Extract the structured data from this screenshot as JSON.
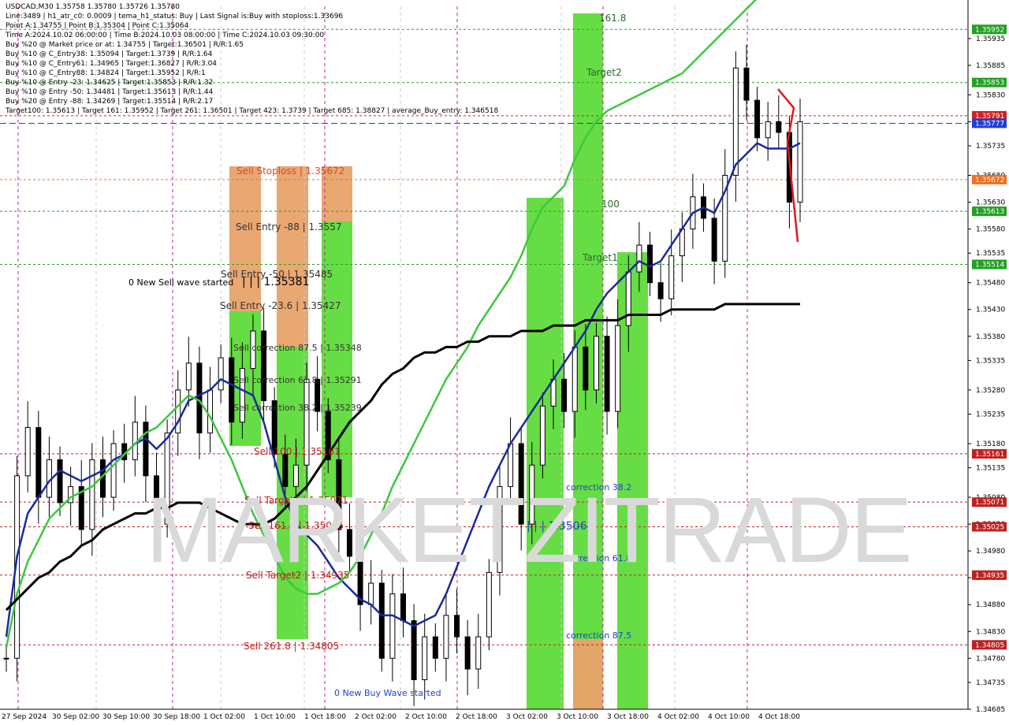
{
  "header": {
    "title": "USDCAD,M30  1.35758 1.35780 1.35726 1.35780",
    "lines": [
      "Line:3489  |  h1_atr_c0: 0.0009  |  tema_h1_status: Buy  |  Last Signal is:Buy with stoploss:1.33696",
      "Point A:1.34755  |  Point B:1.35304  |  Point C:1.35064",
      "Time A:2024.10.02 06:00:00  |  Time B:2024.10.03 08:00:00  |  Time C:2024.10.03 09:30:00",
      "Buy %20 @ Market price or at: 1.34755  |  Target:1.36501  |  R/R:1.65",
      "Buy %10 @ C_Entry38: 1.35094  |  Target:1.3739  |  R/R:1.64",
      "Buy %10 @ C_Entry61: 1.34965  |  Target:1.36827  |  R/R:3.04",
      "Buy %10 @ C_Entry88: 1.34824  |  Target:1.35952  |  R/R:1",
      "Buy %10 @ Entry -23: 1.34625  |  Target:1.35853  |  R/R:1.32",
      "Buy %10 @ Entry -50: 1.34481  |  Target:1.35613  |  R/R:1.44",
      "Buy %20 @ Entry -88: 1.34269  |  Target:1.35514  |  R/R:2.17",
      "Target100: 1.35613  |  Target 161: 1.35952  |  Target 261: 1.36501  |  Target 423: 1.3739  |  Target 685: 1.38827  |  average_Buy_entry: 1.346518"
    ]
  },
  "watermark": "MARKETZITRADE",
  "chart_data": {
    "type": "candlestick",
    "symbol": "USDCAD",
    "timeframe": "M30",
    "ylim": [
      1.34685,
      1.35995
    ],
    "y_ticks": [
      "1.35935",
      "1.35885",
      "1.35830",
      "1.35780",
      "1.35735",
      "1.35680",
      "1.35630",
      "1.35580",
      "1.35535",
      "1.35480",
      "1.35430",
      "1.35380",
      "1.35335",
      "1.35280",
      "1.35235",
      "1.35180",
      "1.35135",
      "1.35080",
      "1.35030",
      "1.34980",
      "1.34930",
      "1.34880",
      "1.34830",
      "1.34780",
      "1.34735",
      "1.34685"
    ],
    "x_ticks": [
      "27 Sep 2024",
      "30 Sep 02:00",
      "30 Sep 10:00",
      "30 Sep 18:00",
      "1 Oct 02:00",
      "1 Oct 10:00",
      "1 Oct 18:00",
      "2 Oct 02:00",
      "2 Oct 10:00",
      "2 Oct 18:00",
      "3 Oct 02:00",
      "3 Oct 10:00",
      "3 Oct 18:00",
      "4 Oct 02:00",
      "4 Oct 10:00",
      "4 Oct 18:00"
    ],
    "price_levels": [
      {
        "value": 1.35952,
        "label": "1.35952",
        "color": "#22a022"
      },
      {
        "value": 1.35853,
        "label": "1.35853",
        "color": "#22a022"
      },
      {
        "value": 1.35791,
        "label": "1.35791",
        "color": "#d42020"
      },
      {
        "value": 1.35777,
        "label": "1.35777",
        "color": "#1f3fd8"
      },
      {
        "value": 1.35672,
        "label": "1.35672",
        "color": "#f07020"
      },
      {
        "value": 1.35613,
        "label": "1.35613",
        "color": "#22a022"
      },
      {
        "value": 1.35514,
        "label": "1.35514",
        "color": "#22a022"
      },
      {
        "value": 1.35161,
        "label": "1.35161",
        "color": "#c02020"
      },
      {
        "value": 1.35071,
        "label": "1.35071",
        "color": "#c02020"
      },
      {
        "value": 1.35025,
        "label": "1.35025",
        "color": "#c02020"
      },
      {
        "value": 1.34935,
        "label": "1.34935",
        "color": "#c02020"
      },
      {
        "value": 1.34805,
        "label": "1.34805",
        "color": "#c02020"
      }
    ],
    "annotations": [
      "Sell Stoploss | 1.35672",
      "Sell Entry -88 | 1.3557",
      "Sell Entry -50 | 1.35485",
      "Sell Entry -23.6 | 1.35427",
      "Sell correction 87.5 | 1.35348",
      "Sell correction 61.8 | 1.35291",
      "Sell correction 38.2 | 1.35239",
      "Sell 100 | 1.35161",
      "Sell Target1 | 1.35071",
      "Sell 161.8 | 1.35025",
      "Sell Target2 | 1.34935",
      "Sell 261.8 | 1.34805",
      "0 New Sell wave started",
      "| | | 1.35381",
      "0 New Buy Wave started",
      "| | | 1.35064",
      "correction 38.2",
      "correction 61.8",
      "correction 87.5",
      "161.8",
      "Target2",
      "100",
      "Target1"
    ],
    "series": [
      {
        "name": "price",
        "color": "#000000",
        "close": [
          1.3478,
          1.3512,
          1.3521,
          1.3508,
          1.3515,
          1.3507,
          1.351,
          1.3502,
          1.3515,
          1.3508,
          1.3518,
          1.3515,
          1.3522,
          1.3512,
          1.3503,
          1.352,
          1.3528,
          1.3533,
          1.352,
          1.3528,
          1.3534,
          1.3522,
          1.3532,
          1.3539,
          1.3526,
          1.3516,
          1.351,
          1.3514,
          1.353,
          1.3524,
          1.3515,
          1.3502,
          1.3497,
          1.3488,
          1.3492,
          1.3478,
          1.349,
          1.3485,
          1.3474,
          1.3482,
          1.3478,
          1.3486,
          1.3482,
          1.3476,
          1.3482,
          1.3494,
          1.351,
          1.3518,
          1.3503,
          1.3514,
          1.3525,
          1.353,
          1.3524,
          1.3536,
          1.3528,
          1.3538,
          1.3524,
          1.354,
          1.355,
          1.3555,
          1.3548,
          1.3545,
          1.3553,
          1.3558,
          1.3564,
          1.356,
          1.3552,
          1.3568,
          1.3588,
          1.3582,
          1.3575,
          1.3578,
          1.3576,
          1.3563,
          1.3578
        ]
      },
      {
        "name": "ema_fast",
        "color": "#1a2a9c",
        "values": [
          1.3482,
          1.3497,
          1.3505,
          1.3508,
          1.3511,
          1.3513,
          1.3512,
          1.3511,
          1.3512,
          1.3513,
          1.3515,
          1.3516,
          1.3518,
          1.3519,
          1.3517,
          1.3519,
          1.3522,
          1.3526,
          1.3527,
          1.3528,
          1.353,
          1.3529,
          1.3528,
          1.3527,
          1.3522,
          1.3515,
          1.3508,
          1.3503,
          1.3501,
          1.3499,
          1.3496,
          1.3493,
          1.3491,
          1.3489,
          1.3488,
          1.3486,
          1.3486,
          1.3485,
          1.3484,
          1.3485,
          1.3486,
          1.349,
          1.3495,
          1.35,
          1.3505,
          1.351,
          1.3514,
          1.3518,
          1.3521,
          1.3524,
          1.3527,
          1.353,
          1.3533,
          1.3536,
          1.3539,
          1.3543,
          1.3546,
          1.3548,
          1.355,
          1.3552,
          1.3551,
          1.3552,
          1.3555,
          1.3558,
          1.3561,
          1.3562,
          1.3561,
          1.3565,
          1.357,
          1.3572,
          1.3574,
          1.3573,
          1.3573,
          1.3573,
          1.3574
        ]
      },
      {
        "name": "ema_mid",
        "color": "#3cc83c",
        "values": [
          1.348,
          1.349,
          1.3496,
          1.35,
          1.3504,
          1.3506,
          1.3508,
          1.3509,
          1.351,
          1.3512,
          1.3514,
          1.3516,
          1.3518,
          1.352,
          1.3521,
          1.3523,
          1.3525,
          1.3527,
          1.3526,
          1.3523,
          1.3519,
          1.3515,
          1.351,
          1.3505,
          1.3501,
          1.3497,
          1.3493,
          1.3491,
          1.349,
          1.349,
          1.3491,
          1.3492,
          1.3494,
          1.3497,
          1.3501,
          1.3505,
          1.351,
          1.3514,
          1.3518,
          1.3522,
          1.3526,
          1.353,
          1.3533,
          1.3536,
          1.354,
          1.3543,
          1.3546,
          1.3549,
          1.3553,
          1.3558,
          1.3562,
          1.3564,
          1.3566,
          1.3571,
          1.3575,
          1.3578,
          1.358,
          1.3581,
          1.3582,
          1.3583,
          1.3584,
          1.3585,
          1.3586,
          1.3587,
          1.3589,
          1.3591,
          1.3593,
          1.3595,
          1.3597,
          1.3599,
          1.3601,
          1.3603,
          1.3605,
          1.3607,
          1.3609
        ]
      },
      {
        "name": "ema_slow",
        "color": "#000000",
        "values": [
          1.3487,
          1.3489,
          1.3491,
          1.3493,
          1.3494,
          1.3496,
          1.3497,
          1.3499,
          1.35,
          1.3502,
          1.3503,
          1.3504,
          1.3505,
          1.3505,
          1.3506,
          1.3506,
          1.3507,
          1.3507,
          1.3507,
          1.3506,
          1.3505,
          1.3504,
          1.3503,
          1.3503,
          1.3503,
          1.3504,
          1.3506,
          1.3508,
          1.351,
          1.3513,
          1.3516,
          1.3519,
          1.3522,
          1.3524,
          1.3526,
          1.3529,
          1.3531,
          1.3532,
          1.3534,
          1.3535,
          1.3535,
          1.3536,
          1.3536,
          1.3537,
          1.3537,
          1.3538,
          1.3538,
          1.3538,
          1.3539,
          1.3539,
          1.3539,
          1.354,
          1.354,
          1.354,
          1.3541,
          1.3541,
          1.3541,
          1.3541,
          1.3542,
          1.3542,
          1.3542,
          1.3542,
          1.3543,
          1.3543,
          1.3543,
          1.3543,
          1.3543,
          1.3544,
          1.3544,
          1.3544,
          1.3544,
          1.3544,
          1.3544,
          1.3544,
          1.3544
        ]
      }
    ]
  }
}
